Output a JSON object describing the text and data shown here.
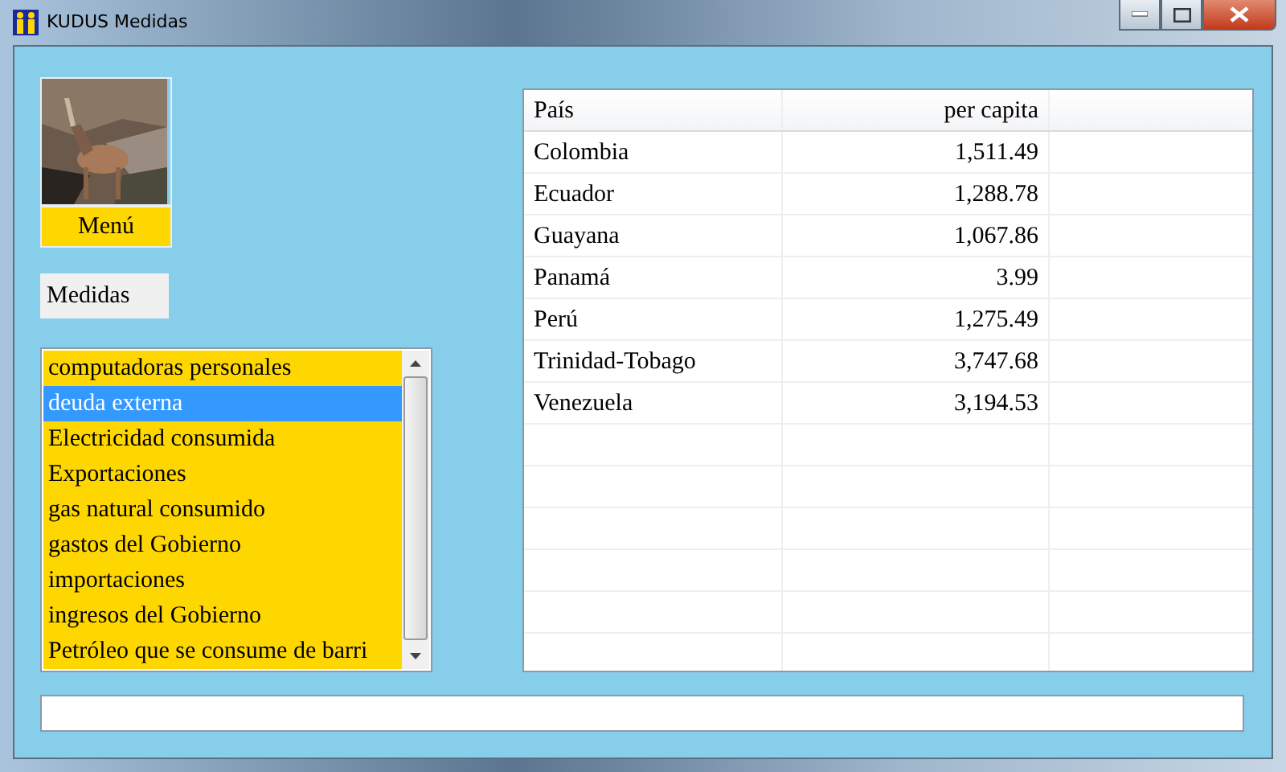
{
  "window": {
    "title": "KUDUS Medidas"
  },
  "menu_button": {
    "label": "Menú"
  },
  "medidas_label": "Medidas",
  "measures_list": [
    {
      "label": "computadoras personales",
      "selected": false
    },
    {
      "label": "deuda externa",
      "selected": true
    },
    {
      "label": "Electricidad consumida",
      "selected": false
    },
    {
      "label": "Exportaciones",
      "selected": false
    },
    {
      "label": "gas natural consumido",
      "selected": false
    },
    {
      "label": "gastos del Gobierno",
      "selected": false
    },
    {
      "label": "importaciones",
      "selected": false
    },
    {
      "label": "ingresos del Gobierno",
      "selected": false
    },
    {
      "label": "Petróleo que se consume de barri",
      "selected": false
    }
  ],
  "table": {
    "columns": [
      "País",
      "per capita"
    ],
    "rows": [
      [
        "Colombia",
        "1,511.49"
      ],
      [
        "Ecuador",
        "1,288.78"
      ],
      [
        "Guayana",
        "1,067.86"
      ],
      [
        "Panamá",
        "3.99"
      ],
      [
        "Perú",
        "1,275.49"
      ],
      [
        "Trinidad-Tobago",
        "3,747.68"
      ],
      [
        "Venezuela",
        "3,194.53"
      ]
    ]
  }
}
